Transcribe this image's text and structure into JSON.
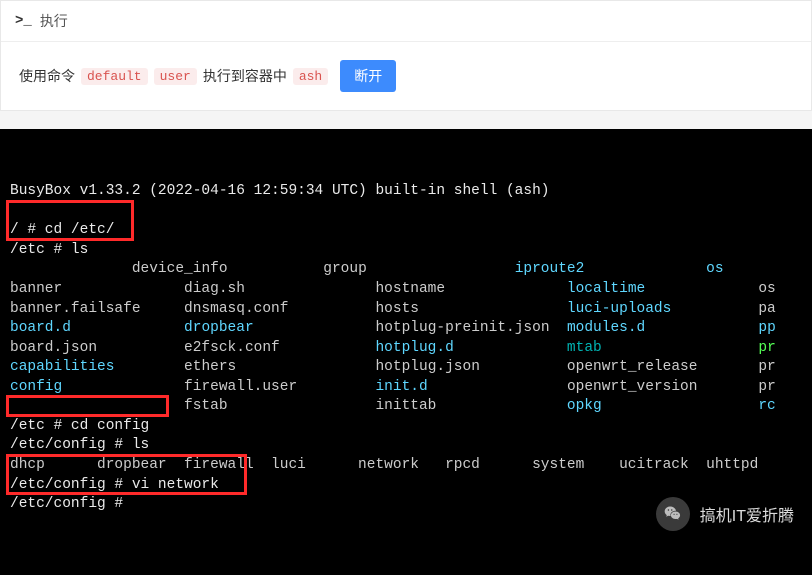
{
  "header": {
    "icon_text": ">_",
    "title": "执行"
  },
  "infobar": {
    "t1": "使用命令",
    "chip1": "default",
    "chip2": "user",
    "t2": "执行到容器中",
    "chip3": "ash",
    "btn": "断开"
  },
  "terminal": {
    "banner": "BusyBox v1.33.2 (2022-04-16 12:59:34 UTC) built-in shell (ash)",
    "cmd1": "/ # cd /etc/",
    "cmd2": "/etc # ls",
    "ls1": [
      {
        "c": [
          {
            "t": "              ",
            "cls": ""
          },
          {
            "t": "device_info           ",
            "cls": ""
          },
          {
            "t": "group                 ",
            "cls": ""
          },
          {
            "t": "iproute2",
            "cls": "cyan"
          },
          {
            "t": "              ",
            "cls": ""
          },
          {
            "t": "os",
            "cls": "cyan"
          }
        ]
      },
      {
        "c": [
          {
            "t": "banner              ",
            "cls": ""
          },
          {
            "t": "diag.sh               ",
            "cls": ""
          },
          {
            "t": "hostname              ",
            "cls": ""
          },
          {
            "t": "localtime",
            "cls": "cyan"
          },
          {
            "t": "             ",
            "cls": ""
          },
          {
            "t": "os",
            "cls": ""
          }
        ]
      },
      {
        "c": [
          {
            "t": "banner.failsafe     ",
            "cls": ""
          },
          {
            "t": "dnsmasq.conf          ",
            "cls": ""
          },
          {
            "t": "hosts                 ",
            "cls": ""
          },
          {
            "t": "luci-uploads",
            "cls": "cyan"
          },
          {
            "t": "          ",
            "cls": ""
          },
          {
            "t": "pa",
            "cls": ""
          }
        ]
      },
      {
        "c": [
          {
            "t": "board.d",
            "cls": "cyan"
          },
          {
            "t": "             ",
            "cls": ""
          },
          {
            "t": "dropbear",
            "cls": "cyan"
          },
          {
            "t": "              ",
            "cls": ""
          },
          {
            "t": "hotplug-preinit.json  ",
            "cls": ""
          },
          {
            "t": "modules.d",
            "cls": "cyan"
          },
          {
            "t": "             ",
            "cls": ""
          },
          {
            "t": "pp",
            "cls": "cyan"
          }
        ]
      },
      {
        "c": [
          {
            "t": "board.json          ",
            "cls": ""
          },
          {
            "t": "e2fsck.conf           ",
            "cls": ""
          },
          {
            "t": "hotplug.d",
            "cls": "cyan"
          },
          {
            "t": "             ",
            "cls": ""
          },
          {
            "t": "mtab",
            "cls": "teal"
          },
          {
            "t": "                  ",
            "cls": ""
          },
          {
            "t": "pr",
            "cls": "green"
          }
        ]
      },
      {
        "c": [
          {
            "t": "capabilities",
            "cls": "cyan"
          },
          {
            "t": "        ",
            "cls": ""
          },
          {
            "t": "ethers                ",
            "cls": ""
          },
          {
            "t": "hotplug.json          ",
            "cls": ""
          },
          {
            "t": "openwrt_release       ",
            "cls": ""
          },
          {
            "t": "pr",
            "cls": ""
          }
        ]
      },
      {
        "c": [
          {
            "t": "config",
            "cls": "cyan"
          },
          {
            "t": "              ",
            "cls": ""
          },
          {
            "t": "firewall.user         ",
            "cls": ""
          },
          {
            "t": "init.d",
            "cls": "cyan"
          },
          {
            "t": "                ",
            "cls": ""
          },
          {
            "t": "openwrt_version       ",
            "cls": ""
          },
          {
            "t": "pr",
            "cls": ""
          }
        ]
      },
      {
        "c": [
          {
            "t": "                    ",
            "cls": ""
          },
          {
            "t": "fstab                 ",
            "cls": ""
          },
          {
            "t": "inittab               ",
            "cls": ""
          },
          {
            "t": "opkg",
            "cls": "cyan"
          },
          {
            "t": "                  ",
            "cls": ""
          },
          {
            "t": "rc",
            "cls": "cyan"
          }
        ]
      }
    ],
    "cmd3": "/etc # cd config",
    "cmd4": "/etc/config # ls",
    "ls2": "dhcp      dropbear  firewall  luci      network   rpcd      system    ucitrack  uhttpd",
    "cmd5": "/etc/config # vi network",
    "cmd6": "/etc/config # "
  },
  "watermark": {
    "text": "搞机IT爱折腾"
  }
}
